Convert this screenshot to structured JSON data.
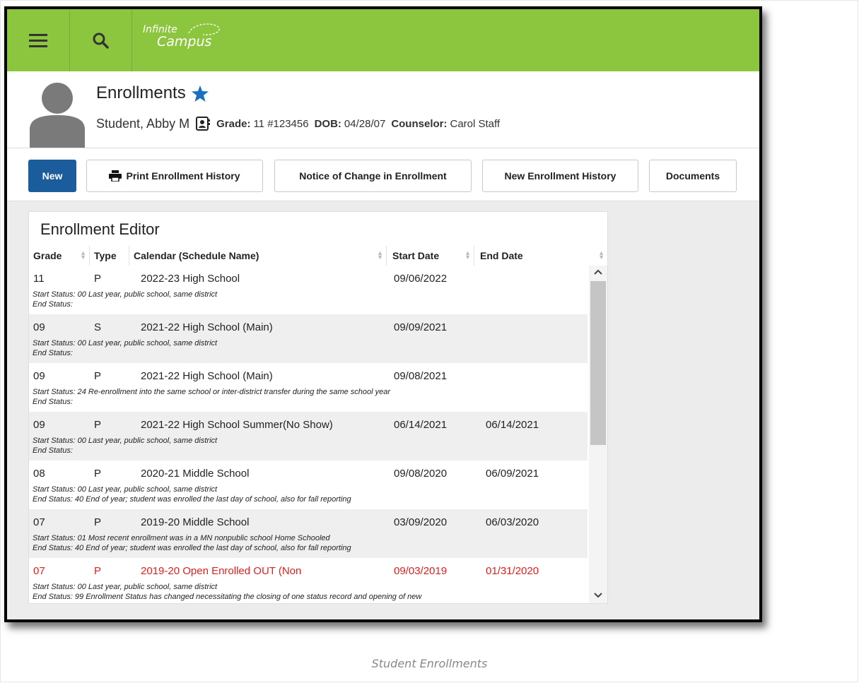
{
  "app": {
    "logo_line1": "Infinite",
    "logo_line2": "Campus",
    "brand_color": "#8cc63f"
  },
  "header": {
    "title": "Enrollments",
    "student_name": "Student, Abby M",
    "grade_label": "Grade:",
    "grade_value": "11 #123456",
    "dob_label": "DOB:",
    "dob_value": "04/28/07",
    "counselor_label": "Counselor:",
    "counselor_value": "Carol Staff"
  },
  "toolbar": {
    "new_label": "New",
    "print_label": "Print Enrollment History",
    "notice_label": "Notice of Change in Enrollment",
    "new_history_label": "New Enrollment History",
    "documents_label": "Documents"
  },
  "editor": {
    "title": "Enrollment Editor",
    "columns": [
      "Grade",
      "Type",
      "Calendar (Schedule Name)",
      "Start Date",
      "End Date"
    ],
    "rows": [
      {
        "grade": "11",
        "type": "P",
        "calendar": "2022-23 High School",
        "start": "09/06/2022",
        "end": "",
        "start_status": "Start Status: 00 Last year, public school, same district",
        "end_status": "End Status:"
      },
      {
        "grade": "09",
        "type": "S",
        "calendar": "2021-22 High School (Main)",
        "start": "09/09/2021",
        "end": "",
        "start_status": "Start Status: 00 Last year, public school, same district",
        "end_status": "End Status:"
      },
      {
        "grade": "09",
        "type": "P",
        "calendar": "2021-22 High School (Main)",
        "start": "09/08/2021",
        "end": "",
        "start_status": "Start Status: 24 Re-enrollment into the same school or inter-district transfer during the same school year",
        "end_status": "End Status:"
      },
      {
        "grade": "09",
        "type": "P",
        "calendar": "2021-22 High School Summer(No Show)",
        "start": "06/14/2021",
        "end": "06/14/2021",
        "start_status": "Start Status: 00 Last year, public school, same district",
        "end_status": "End Status:"
      },
      {
        "grade": "08",
        "type": "P",
        "calendar": "2020-21 Middle School",
        "start": "09/08/2020",
        "end": "06/09/2021",
        "start_status": "Start Status: 00 Last year, public school, same district",
        "end_status": "End Status:  40 End of year; student was enrolled the last day of school, also for fall reporting"
      },
      {
        "grade": "07",
        "type": "P",
        "calendar": "2019-20 Middle School",
        "start": "03/09/2020",
        "end": "06/03/2020",
        "start_status": "Start Status: 01 Most recent enrollment was in a MN nonpublic school Home Schooled",
        "end_status": "End Status:  40 End of year; student was enrolled the last day of school, also for fall reporting"
      },
      {
        "grade": "07",
        "type": "P",
        "calendar": "2019-20 Open Enrolled OUT (Non",
        "start": "09/03/2019",
        "end": "01/31/2020",
        "start_status": "Start Status: 00 Last year, public school, same district",
        "end_status": "End Status:  99 Enrollment Status has changed necessitating the closing of one status record and opening of new"
      }
    ]
  },
  "caption": "Student Enrollments"
}
